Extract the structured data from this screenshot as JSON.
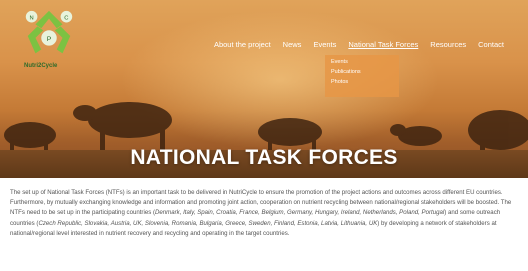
{
  "brand": {
    "name": "Nutri2Cycle"
  },
  "nav": {
    "items": [
      "About the project",
      "News",
      "Events",
      "National Task Forces",
      "Resources",
      "Contact"
    ],
    "active": "National Task Forces"
  },
  "dropdown": {
    "items": [
      "Events",
      "Publications",
      "Photos"
    ]
  },
  "hero": {
    "title": "NATIONAL TASK FORCES"
  },
  "body": {
    "p1": "The set up of National Task Forces (NTFs) is an important task to be delivered in NutriCycle to ensure the promotion of the project actions and outcomes across different EU countries. Furthermore, by mutually exchanging knowledge and information and promoting joint action, cooperation on nutrient recycling between national/regional stakeholders will be boosted. The NTFs need to be set up in the participating countries (",
    "countries1": "Denmark, Italy, Spain, Croatia, France, Belgium, Germany, Hungary, Ireland, Netherlands, Poland, Portugal",
    "p2": ") and some outreach countries (",
    "countries2": "Czech Republic, Slovakia, Austria, UK, Slovenia, Romania, Bulgaria, Greece, Sweden, Finland, Estonia, Latvia, Lithuania, UK",
    "p3": ") by developing a network of stakeholders at national/regional level interested in nutrient recovery and recycling and operating in the target countries."
  },
  "colors": {
    "hero_top": "#e0a35a",
    "hero_bottom": "#8a4e24",
    "logo_green": "#7cc242",
    "text": "#555555"
  },
  "icons": [
    "recycle-logo-icon"
  ]
}
